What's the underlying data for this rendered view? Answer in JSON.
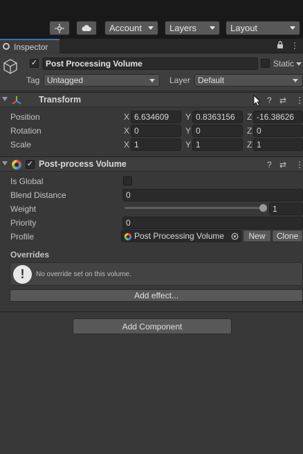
{
  "toolbar": {
    "account_label": "Account",
    "layers_label": "Layers",
    "layout_label": "Layout"
  },
  "tab": {
    "label": "Inspector"
  },
  "object": {
    "name": "Post Processing Volume",
    "static_label": "Static",
    "tag_label": "Tag",
    "tag_value": "Untagged",
    "layer_label": "Layer",
    "layer_value": "Default"
  },
  "transform": {
    "title": "Transform",
    "rows": [
      {
        "label": "Position",
        "x": "6.634609",
        "y": "0.8363156",
        "z": "-16.38626"
      },
      {
        "label": "Rotation",
        "x": "0",
        "y": "0",
        "z": "0"
      },
      {
        "label": "Scale",
        "x": "1",
        "y": "1",
        "z": "1"
      }
    ],
    "axes": {
      "x": "X",
      "y": "Y",
      "z": "Z"
    }
  },
  "volume": {
    "title": "Post-process Volume",
    "is_global_label": "Is Global",
    "blend_label": "Blend Distance",
    "blend_value": "0",
    "weight_label": "Weight",
    "weight_value": "1",
    "weight_fraction": 1.0,
    "priority_label": "Priority",
    "priority_value": "0",
    "profile_label": "Profile",
    "profile_value": "Post Processing Volume",
    "new_label": "New",
    "clone_label": "Clone",
    "overrides_label": "Overrides",
    "no_override_msg": "No override set on this volume.",
    "add_effect_label": "Add effect..."
  },
  "add_component_label": "Add Component"
}
